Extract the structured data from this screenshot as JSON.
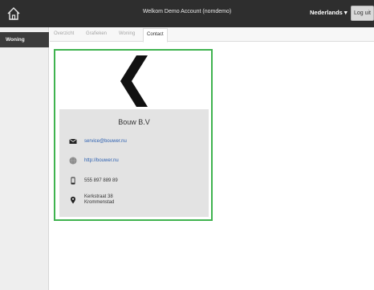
{
  "header": {
    "welcome": "Welkom Demo Account (nomdemo)",
    "language": "Nederlands ▾",
    "logout_label": "Log uit",
    "home_icon": "home-icon"
  },
  "sidebar": {
    "items": [
      {
        "label": "Woning"
      }
    ]
  },
  "tabs": [
    {
      "label": "Overzicht"
    },
    {
      "label": "Grafieken"
    },
    {
      "label": "Woning"
    },
    {
      "label": "Contact"
    }
  ],
  "contact": {
    "company": "Bouw B.V",
    "email": "service@bouwer.nu",
    "website": "http://bouwer.nu",
    "phone": "555 897 889 89",
    "address_line1": "Kerkstraat 38",
    "address_line2": "Krommenstad"
  },
  "colors": {
    "topbar": "#2e2e2e",
    "card_border": "#3fb34f",
    "link": "#2b5fb0",
    "panel": "#e3e3e3"
  }
}
